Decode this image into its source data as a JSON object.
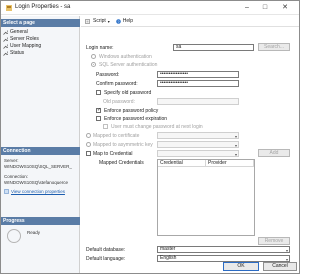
{
  "window": {
    "title": "Login Properties - sa"
  },
  "sidebar": {
    "select_page": "Select a page",
    "pages": [
      "General",
      "Server Roles",
      "User Mapping",
      "Status"
    ],
    "connection_header": "Connection",
    "server_label": "Server:",
    "server_value": "WINDOWS10SQ\\SQL_SERVER_",
    "connection_label": "Connection:",
    "connection_value": "WINDOWS10SQ\\stefanoquerce",
    "view_link": "View connection properties",
    "progress_header": "Progress",
    "progress_status": "Ready"
  },
  "toolbar": {
    "script": "Script",
    "help": "Help"
  },
  "form": {
    "login_name_label": "Login name:",
    "login_name_value": "sa",
    "search_button": "Search...",
    "windows_auth": "Windows authentication",
    "sql_auth": "SQL Server authentication",
    "password_label": "Password:",
    "password_value": "••••••••••••••••",
    "confirm_label": "Confirm password:",
    "confirm_value": "••••••••••••••••",
    "specify_old": "Specify old password",
    "old_password": "Old password:",
    "enforce_policy": "Enforce password policy",
    "enforce_expiration": "Enforce password expiration",
    "must_change": "User must change password at next login",
    "mapped_cert": "Mapped to certificate",
    "mapped_asym": "Mapped to asymmetric key",
    "map_credential": "Map to Credential",
    "add_button": "Add",
    "mapped_credentials": "Mapped Credentials",
    "col_credential": "Credential",
    "col_provider": "Provider",
    "remove_button": "Remove",
    "default_db_label": "Default database:",
    "default_db_value": "master",
    "default_lang_label": "Default language:",
    "default_lang_value": "English"
  },
  "buttons": {
    "ok": "OK",
    "cancel": "Cancel"
  },
  "colors": {
    "sidebar_header": "#5a7ca6",
    "link": "#1c5eb0",
    "ok_border": "#2c6cc4"
  }
}
